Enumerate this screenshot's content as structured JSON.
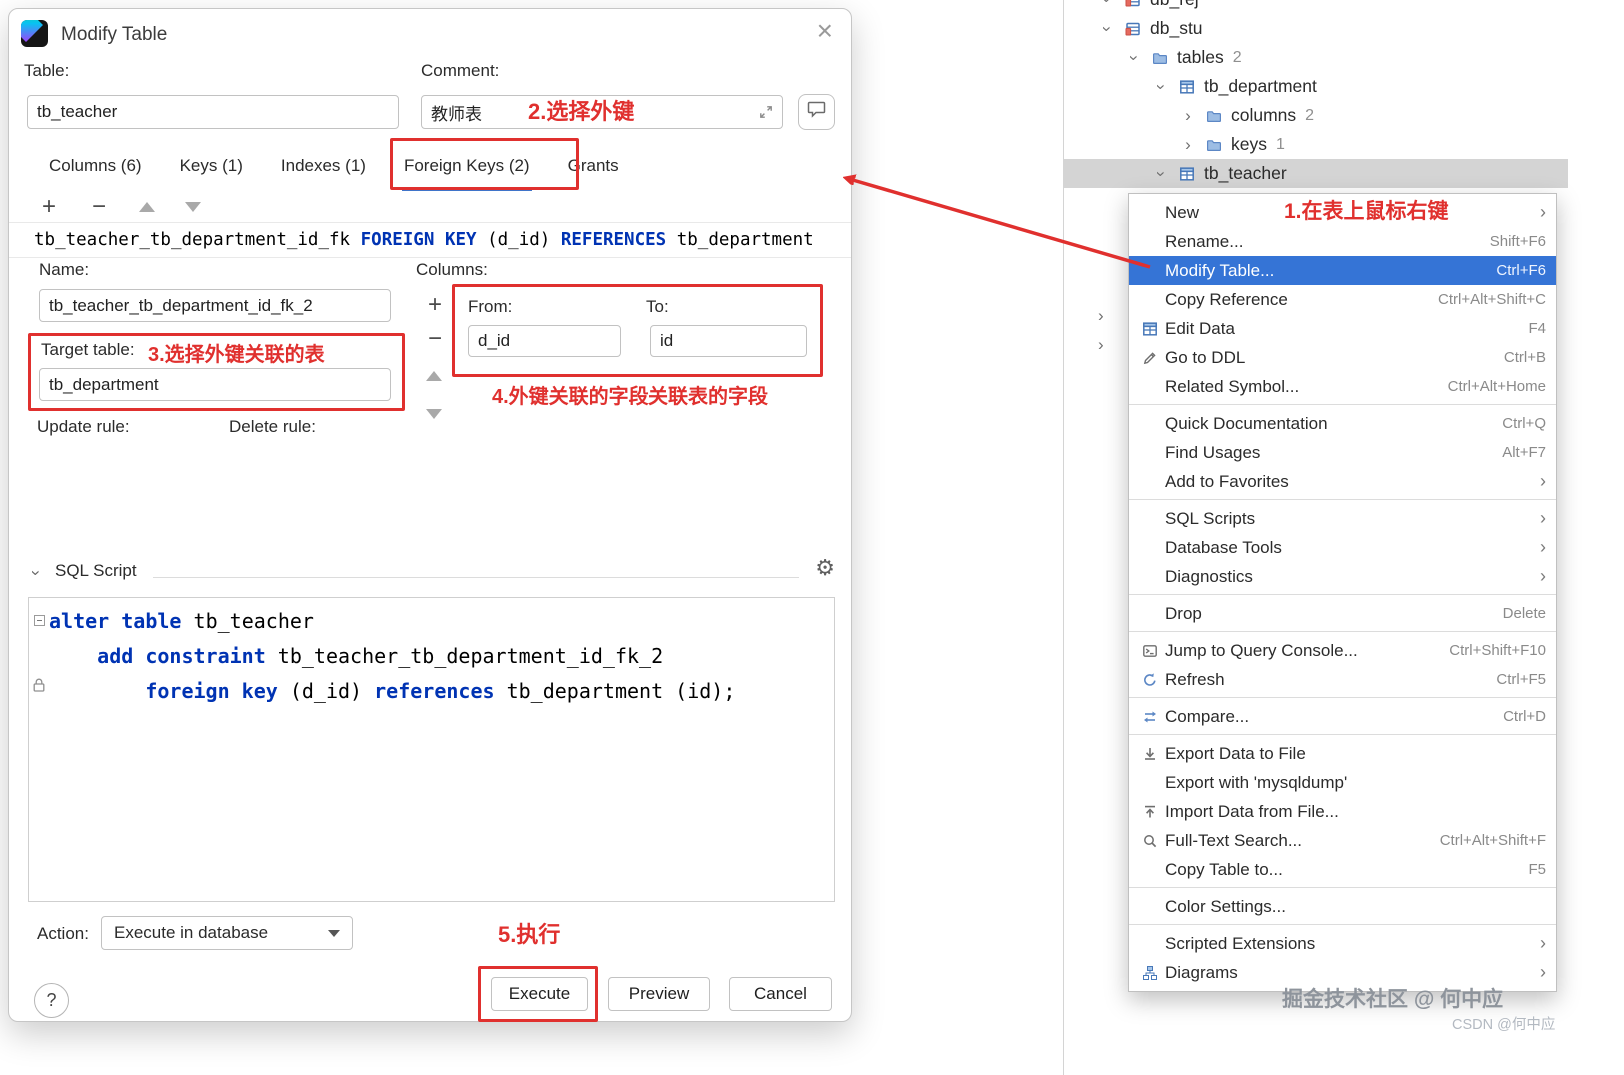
{
  "accent": {
    "annotation_red": "#e0302e",
    "selection_blue": "#3574d6",
    "keyword_blue": "#0033b3"
  },
  "icons": {
    "close": "×",
    "gear": "⚙",
    "plus": "+",
    "minus": "−",
    "submenu_arrow": "›",
    "chevron": "›",
    "help": "?"
  },
  "dialog": {
    "title": "Modify Table",
    "fields": {
      "table_label": "Table:",
      "table_value": "tb_teacher",
      "comment_label": "Comment:",
      "comment_value": "教师表"
    },
    "tabs": [
      "Columns (6)",
      "Keys (1)",
      "Indexes (1)",
      "Foreign Keys (2)",
      "Grants"
    ],
    "selected_tab_index": 3,
    "fk_list_line": [
      {
        "t": "id",
        "s": "tb_teacher_tb_department_id_fk "
      },
      {
        "t": "kw",
        "s": "FOREIGN"
      },
      {
        "t": "id",
        "s": " "
      },
      {
        "t": "kw",
        "s": "KEY"
      },
      {
        "t": "id",
        "s": " (d_id) "
      },
      {
        "t": "kw",
        "s": "REFERENCES"
      },
      {
        "t": "id",
        "s": " tb_department"
      }
    ],
    "details": {
      "name_label": "Name:",
      "name_value": "tb_teacher_tb_department_id_fk_2",
      "columns_label": "Columns:",
      "target_table_label": "Target table:",
      "target_table_value": "tb_department",
      "update_rule_label": "Update rule:",
      "delete_rule_label": "Delete rule:",
      "from_label": "From:",
      "from_value": "d_id",
      "to_label": "To:",
      "to_value": "id"
    },
    "sql_section": {
      "label": "SQL Script",
      "lines": [
        [
          {
            "t": "kw",
            "s": "alter"
          },
          {
            "t": "id",
            "s": " "
          },
          {
            "t": "kw",
            "s": "table"
          },
          {
            "t": "id",
            "s": " tb_teacher"
          }
        ],
        [
          {
            "t": "id",
            "s": "    "
          },
          {
            "t": "kw",
            "s": "add"
          },
          {
            "t": "id",
            "s": " "
          },
          {
            "t": "kw",
            "s": "constraint"
          },
          {
            "t": "id",
            "s": " tb_teacher_tb_department_id_fk_2"
          }
        ],
        [
          {
            "t": "id",
            "s": "        "
          },
          {
            "t": "kw",
            "s": "foreign"
          },
          {
            "t": "id",
            "s": " "
          },
          {
            "t": "kw",
            "s": "key"
          },
          {
            "t": "id",
            "s": " (d_id) "
          },
          {
            "t": "kw",
            "s": "references"
          },
          {
            "t": "id",
            "s": " tb_department (id);"
          }
        ]
      ]
    },
    "action": {
      "label": "Action:",
      "value": "Execute in database"
    },
    "buttons": [
      {
        "label": "Execute"
      },
      {
        "label": "Preview"
      },
      {
        "label": "Cancel"
      }
    ]
  },
  "tree": {
    "rows": [
      {
        "label": "db_rej",
        "icon": "db",
        "chevron": "expanded",
        "level": 0,
        "count": ""
      },
      {
        "label": "db_stu",
        "icon": "db",
        "chevron": "expanded",
        "level": 0,
        "count": ""
      },
      {
        "label": "tables",
        "icon": "folder",
        "chevron": "expanded",
        "level": 1,
        "count": "2"
      },
      {
        "label": "tb_department",
        "icon": "table",
        "chevron": "expanded",
        "level": 2,
        "count": ""
      },
      {
        "label": "columns",
        "icon": "folder",
        "chevron": "collapsed",
        "level": 3,
        "count": "2"
      },
      {
        "label": "keys",
        "icon": "folder",
        "chevron": "collapsed",
        "level": 3,
        "count": "1"
      },
      {
        "label": "tb_teacher",
        "icon": "table",
        "chevron": "expanded",
        "level": 2,
        "count": "",
        "selected": true
      }
    ]
  },
  "context_menu": {
    "items": [
      {
        "label": "New",
        "submenu": true
      },
      {
        "label": "Rename...",
        "shortcut": "Shift+F6"
      },
      {
        "label": "Modify Table...",
        "shortcut": "Ctrl+F6",
        "selected": true
      },
      {
        "label": "Copy Reference",
        "shortcut": "Ctrl+Alt+Shift+C"
      },
      {
        "label": "Edit Data",
        "shortcut": "F4",
        "icon": "table"
      },
      {
        "label": "Go to DDL",
        "shortcut": "Ctrl+B",
        "icon": "pencil"
      },
      {
        "label": "Related Symbol...",
        "shortcut": "Ctrl+Alt+Home"
      },
      {
        "sep": true
      },
      {
        "label": "Quick Documentation",
        "shortcut": "Ctrl+Q"
      },
      {
        "label": "Find Usages",
        "shortcut": "Alt+F7"
      },
      {
        "label": "Add to Favorites",
        "submenu": true
      },
      {
        "sep": true
      },
      {
        "label": "SQL Scripts",
        "submenu": true
      },
      {
        "label": "Database Tools",
        "submenu": true
      },
      {
        "label": "Diagnostics",
        "submenu": true
      },
      {
        "sep": true
      },
      {
        "label": "Drop",
        "shortcut": "Delete"
      },
      {
        "sep": true
      },
      {
        "label": "Jump to Query Console...",
        "shortcut": "Ctrl+Shift+F10",
        "icon": "console"
      },
      {
        "label": "Refresh",
        "shortcut": "Ctrl+F5",
        "icon": "refresh"
      },
      {
        "sep": true
      },
      {
        "label": "Compare...",
        "shortcut": "Ctrl+D",
        "icon": "compare"
      },
      {
        "sep": true
      },
      {
        "label": "Export Data to File",
        "icon": "download"
      },
      {
        "label": "Export with 'mysqldump'"
      },
      {
        "label": "Import Data from File...",
        "icon": "upload"
      },
      {
        "label": "Full-Text Search...",
        "shortcut": "Ctrl+Alt+Shift+F",
        "icon": "search"
      },
      {
        "label": "Copy Table to...",
        "shortcut": "F5"
      },
      {
        "sep": true
      },
      {
        "label": "Color Settings..."
      },
      {
        "sep": true
      },
      {
        "label": "Scripted Extensions",
        "submenu": true
      },
      {
        "label": "Diagrams",
        "submenu": true,
        "icon": "diagram"
      }
    ]
  },
  "annotations": {
    "step1": "1.在表上鼠标右键",
    "step2": "2.选择外键",
    "step3": "3.选择外键关联的表",
    "step4a": "4.外键关联的字段",
    "step4b": "关联表的字段",
    "step5": "5.执行"
  },
  "watermark": {
    "line1": "掘金技术社区 @ 何中应",
    "line2": "CSDN @何中应"
  }
}
